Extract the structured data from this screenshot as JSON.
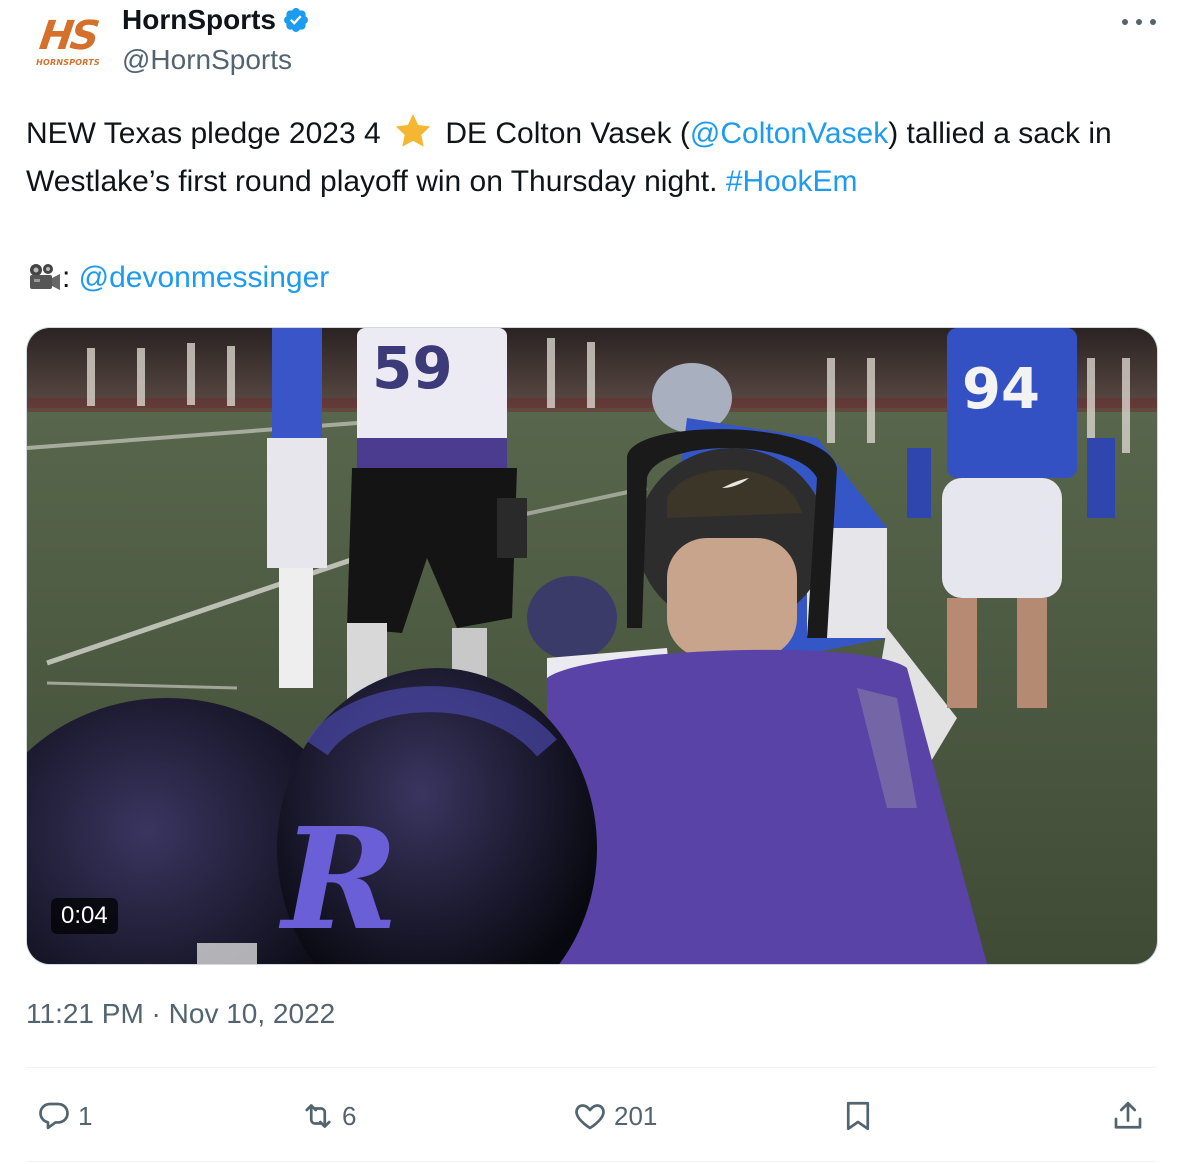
{
  "author": {
    "logo_text": "HS",
    "logo_subtext": "HORNSPORTS",
    "display_name": "HornSports",
    "handle": "@HornSports",
    "verified": true
  },
  "tweet": {
    "text_part1": "NEW Texas pledge 2023 4 ",
    "star_icon": "star-emoji",
    "text_part2": " DE Colton Vasek (",
    "mention1": "@ColtonVasek",
    "text_part3": ") tallied a sack in Westlake’s first round playoff win on Thursday night. ",
    "hashtag": "#HookEm",
    "camera_icon": "movie-camera-emoji",
    "camera_sep": ": ",
    "mention2": "@devonmessinger"
  },
  "media": {
    "duration": "0:04",
    "jersey_left": "59",
    "jersey_right": "94",
    "helmet_logo": "R"
  },
  "timestamp": "11:21 PM · Nov 10, 2022",
  "actions": {
    "replies": "1",
    "retweets": "6",
    "likes": "201"
  },
  "colors": {
    "link": "#1d9bf0",
    "text": "#0f1419",
    "muted": "#536471",
    "brand": "#d4702a"
  }
}
